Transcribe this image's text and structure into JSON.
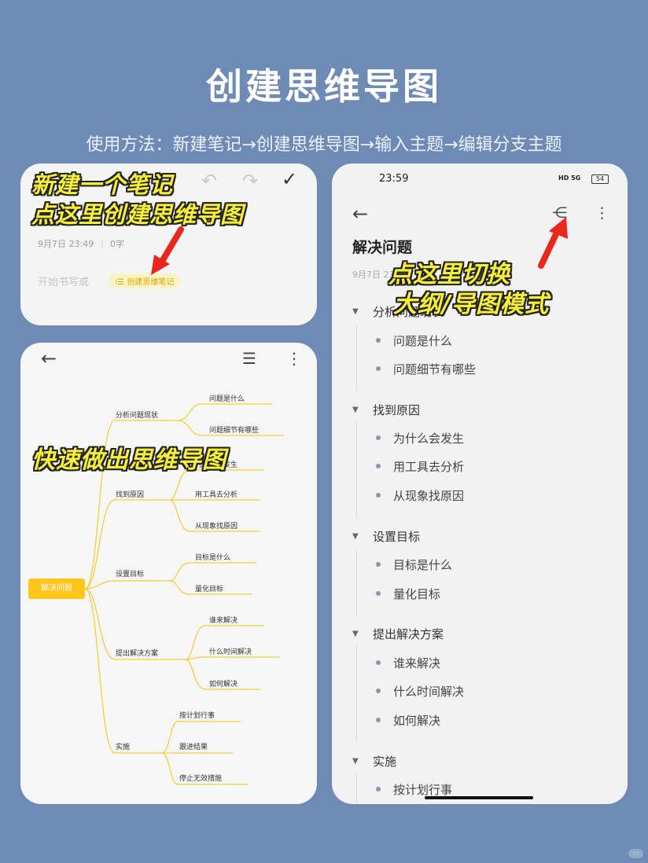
{
  "title": "创建思维导图",
  "subtitle": "使用方法：新建笔记→创建思维导图→输入主题→编辑分支主题",
  "card_a": {
    "callout_line1": "新建一个笔记",
    "callout_line2": "点这里创建思维导图",
    "meta_date": "9月7日 23:49",
    "meta_sep": "|",
    "meta_count": "0字",
    "placeholder": "开始书写或",
    "mindmap_button": "⁝☰ 创建思维笔记",
    "icons": [
      "undo-icon",
      "redo-icon",
      "check-icon"
    ]
  },
  "card_b": {
    "callout": "快速做出思维导图",
    "root": "解决问题",
    "branches": [
      {
        "label": "分析问题现状",
        "children": [
          "问题是什么",
          "问题细节有哪些"
        ]
      },
      {
        "label": "找到原因",
        "children": [
          "为什么会发生",
          "用工具去分析",
          "从现象找原因"
        ]
      },
      {
        "label": "设置目标",
        "children": [
          "目标是什么",
          "量化目标"
        ]
      },
      {
        "label": "提出解决方案",
        "children": [
          "谁来解决",
          "什么时间解决",
          "如何解决"
        ]
      },
      {
        "label": "实施",
        "children": [
          "按计划行事",
          "跟进结果",
          "停止无效措施"
        ]
      }
    ]
  },
  "card_c": {
    "time": "23:59",
    "battery": "54",
    "status_icons": "HD 5G",
    "title": "解决问题",
    "date": "9月7日 23",
    "callout_line1": "点这里切换",
    "callout_line2": "大纲/导图模式",
    "sections": [
      {
        "label": "分析问题现状",
        "items": [
          "问题是什么",
          "问题细节有哪些"
        ]
      },
      {
        "label": "找到原因",
        "items": [
          "为什么会发生",
          "用工具去分析",
          "从现象找原因"
        ]
      },
      {
        "label": "设置目标",
        "items": [
          "目标是什么",
          "量化目标"
        ]
      },
      {
        "label": "提出解决方案",
        "items": [
          "谁来解决",
          "什么时间解决",
          "如何解决"
        ]
      },
      {
        "label": "实施",
        "items": [
          "按计划行事"
        ]
      }
    ]
  },
  "colors": {
    "background": "#6e8bb5",
    "callout_fill": "#f6ef3a",
    "arrow": "#e8271d",
    "mindmap_root": "#ffc51a",
    "mindmap_line": "#f2cf3a"
  }
}
